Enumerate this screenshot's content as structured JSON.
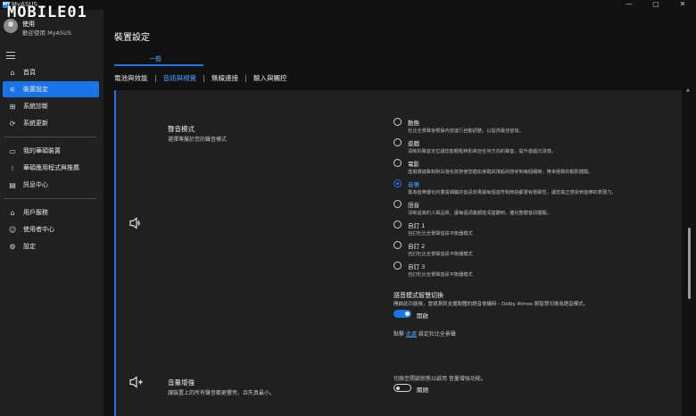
{
  "window": {
    "title": "MyASUS",
    "app_icon": "MY",
    "controls": [
      "—",
      "▢",
      "✕"
    ]
  },
  "watermark": "MOBILE01",
  "user": {
    "name": "使用",
    "welcome": "歡迎使用 MyASUS"
  },
  "sidebar": {
    "items": [
      {
        "label": "首頁",
        "icon": "home-icon"
      },
      {
        "label": "裝置設定",
        "icon": "device-settings-icon",
        "active": true
      },
      {
        "label": "系統診斷",
        "icon": "diagnosis-icon"
      },
      {
        "label": "系統更新",
        "icon": "update-icon"
      },
      {
        "label": "我的華碩裝置",
        "icon": "devices-icon"
      },
      {
        "label": "華碩應用程式與推薦",
        "icon": "apps-icon"
      },
      {
        "label": "訊息中心",
        "icon": "message-icon"
      },
      {
        "label": "用戶服務",
        "icon": "support-icon"
      },
      {
        "label": "使用者中心",
        "icon": "user-icon"
      },
      {
        "label": "設定",
        "icon": "gear-icon"
      }
    ]
  },
  "main": {
    "title": "裝置設定",
    "group_tab": "一般",
    "subtabs": [
      "電池與效能",
      "音訊與視覺",
      "無線連接",
      "輸入與觸控"
    ],
    "active_subtab": "音訊與視覺"
  },
  "sound_mode": {
    "title": "聲音模式",
    "description": "選擇專屬於您的聲音模式",
    "options": [
      {
        "label": "動態",
        "desc": "杜比全景聲會根據內容進行自動調整，以提供最佳音效。",
        "checked": false
      },
      {
        "label": "遊戲",
        "desc": "清晰的聲音定位讓您能輕鬆辨別來自任何方向的聲音，提升遊戲沉浸感。",
        "checked": false
      },
      {
        "label": "電影",
        "desc": "虛擬環繞聲和對白強化技術使您猶如身臨其境般的感受到每個細節，帶來極致的觀影體驗。",
        "checked": false
      },
      {
        "label": "音樂",
        "desc": "專為音樂優化的豐富細膩的音訊效果讓每個音符和節拍都更有衝擊性，讓您真正感受到音樂的表現力。",
        "checked": true
      },
      {
        "label": "語音",
        "desc": "清晰逼真的人聲品質，讓每個詞彙都能清楚聽到，優化整體音訊體驗。",
        "checked": false
      },
      {
        "label": "自訂 1",
        "desc": "自訂杜比全景聲音訊平衡器模式",
        "checked": false
      },
      {
        "label": "自訂 2",
        "desc": "自訂杜比全景聲音訊平衡器模式",
        "checked": false
      },
      {
        "label": "自訂 3",
        "desc": "自訂杜比全景聲音訊平衡器模式",
        "checked": false
      }
    ],
    "smart_switch_title": "語音模式智慧切換",
    "smart_switch_desc": "開啟此功能後，當偵測到支援軟體的語音會議時 - Dolby Atmos 將智慧切換為語音模式。",
    "smart_switch_state": "開啟",
    "footer_prefix": "點擊",
    "footer_link": "此處",
    "footer_suffix": "設定杜比全景聲"
  },
  "volume_boost": {
    "title": "音量增強",
    "description": "讓裝置上的所有聲音都更響亮，且失真最小。",
    "hint": "切換至開啟狀態以啟用 音量增強功能。",
    "state": "關閉"
  },
  "colors": {
    "accent": "#1a73e8",
    "link": "#4aa3ff",
    "panel": "#202020",
    "background": "#111111"
  }
}
